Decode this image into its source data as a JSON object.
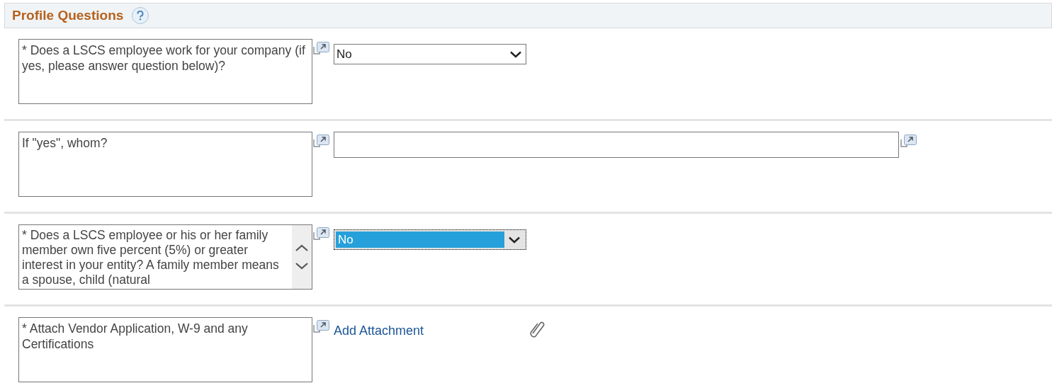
{
  "section": {
    "title": "Profile Questions"
  },
  "questions": [
    {
      "kind": "select",
      "label": "* Does a LSCS employee work for your company (if yes, please answer question below)?",
      "scrollable": false,
      "value": "No",
      "focused": false
    },
    {
      "kind": "text",
      "label": "If \"yes\", whom?",
      "scrollable": false
    },
    {
      "kind": "select",
      "label": "* Does a LSCS employee or his or her family member own five percent (5%) or greater interest in your entity? A family member means a spouse, child (natural",
      "scrollable": true,
      "value": "No",
      "focused": true
    },
    {
      "kind": "attachment",
      "label": "* Attach Vendor Application, W-9 and any Certifications",
      "scrollable": false,
      "link": "Add Attachment"
    }
  ]
}
